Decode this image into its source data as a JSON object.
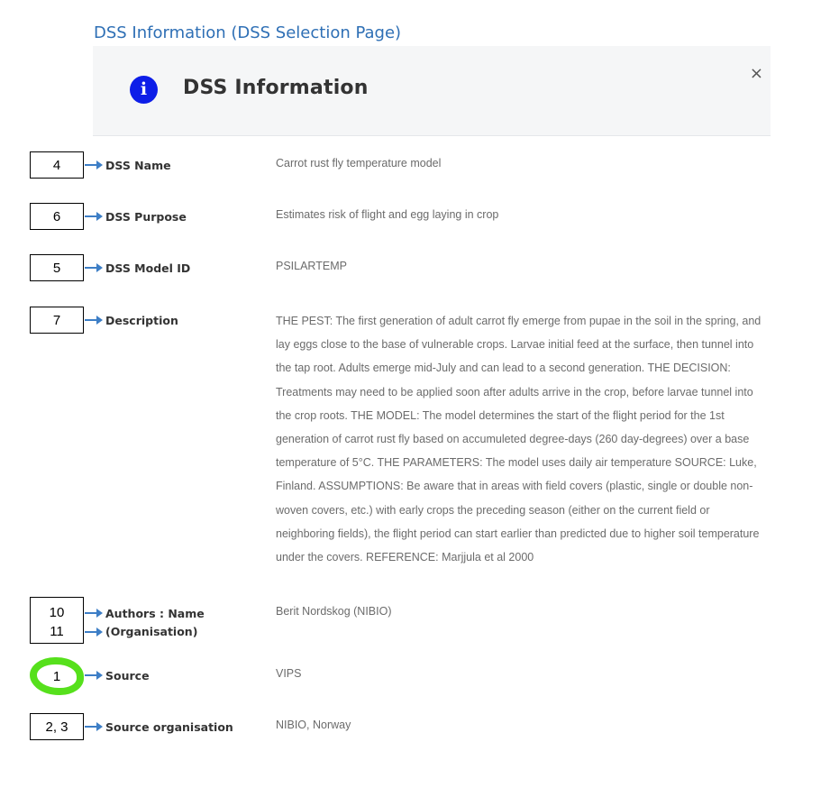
{
  "page_caption": "DSS Information (DSS Selection Page)",
  "modal": {
    "icon": "info-icon",
    "title": "DSS Information",
    "close_label": "×"
  },
  "fields": {
    "dss_name": {
      "annotation": "4",
      "label": "DSS Name",
      "value": "Carrot rust fly temperature model"
    },
    "dss_purpose": {
      "annotation": "6",
      "label": "DSS Purpose",
      "value": "Estimates risk of flight and egg laying in crop"
    },
    "dss_model_id": {
      "annotation": "5",
      "label": "DSS Model ID",
      "value": "PSILARTEMP"
    },
    "description": {
      "annotation": "7",
      "label": "Description",
      "value": "THE PEST: The first generation of adult carrot fly emerge from pupae in the soil in the spring, and lay eggs close to the base of vulnerable crops. Larvae initial feed at the surface, then tunnel into the tap root. Adults emerge mid-July and can lead to a second generation. THE DECISION: Treatments may need to be applied soon after adults arrive in the crop, before larvae tunnel into the crop roots. THE MODEL: The model determines the start of the flight period for the 1st generation of carrot rust fly based on accumuleted degree-days (260 day-degrees) over a base temperature of 5°C. THE PARAMETERS: The model uses daily air temperature SOURCE: Luke, Finland. ASSUMPTIONS: Be aware that in areas with field covers (plastic, single or double non-woven covers, etc.) with early crops the preceding season (either on the current field or neighboring fields), the flight period can start earlier than predicted due to higher soil temperature under the covers. REFERENCE: Marjjula et al 2000"
    },
    "authors": {
      "annotation_1": "10",
      "annotation_2": "11",
      "label_1": "Authors : Name",
      "label_2": "(Organisation)",
      "value": "Berit Nordskog (NIBIO)"
    },
    "source": {
      "annotation": "1",
      "label": "Source",
      "value": "VIPS"
    },
    "source_organisation": {
      "annotation": "2, 3",
      "label": "Source organisation",
      "value": "NIBIO, Norway"
    }
  },
  "colors": {
    "caption": "#2e6fb5",
    "info_icon": "#0d1ee8",
    "arrow": "#3d7ec6",
    "highlight": "#56e01c"
  }
}
